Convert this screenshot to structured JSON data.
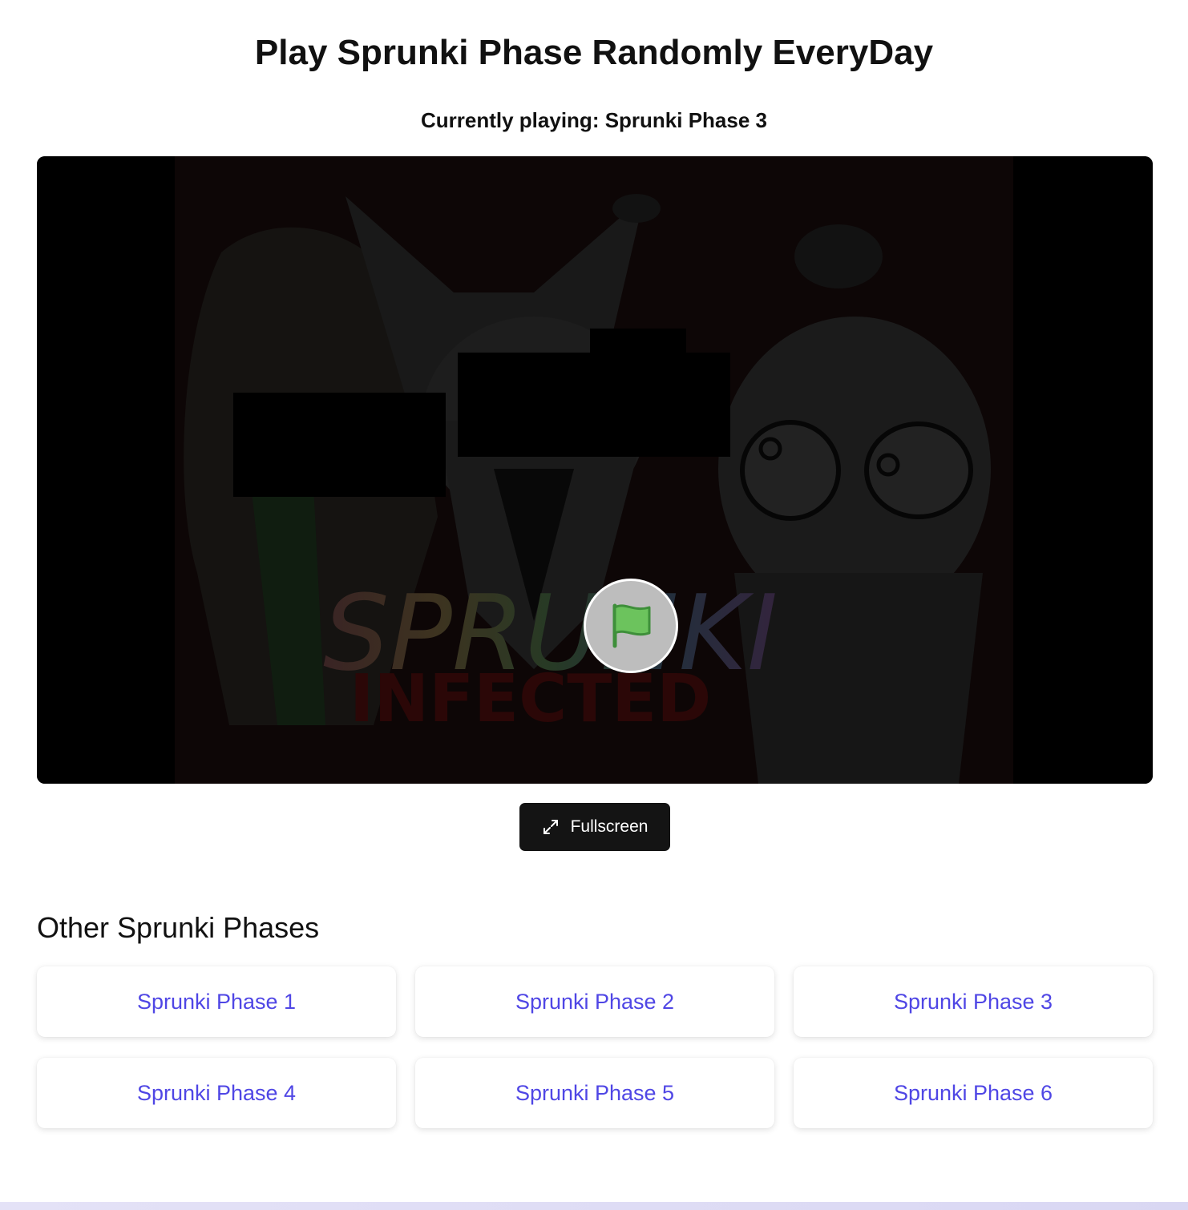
{
  "header": {
    "title": "Play Sprunki Phase Randomly EveryDay",
    "now_playing": "Currently playing: Sprunki Phase 3"
  },
  "player": {
    "background": "#000000",
    "artwork_title": "SPRUNKI",
    "artwork_subtitle": "INFECTED",
    "play_icon": "green-flag-icon",
    "play_button_color": "#bdbdbd",
    "flag_color": "#6cc35d"
  },
  "controls": {
    "fullscreen_label": "Fullscreen",
    "fullscreen_icon": "expand-arrows-icon"
  },
  "other_phases": {
    "heading": "Other Sprunki Phases",
    "link_color": "#4f46e5",
    "items": [
      {
        "label": "Sprunki Phase 1"
      },
      {
        "label": "Sprunki Phase 2"
      },
      {
        "label": "Sprunki Phase 3"
      },
      {
        "label": "Sprunki Phase 4"
      },
      {
        "label": "Sprunki Phase 5"
      },
      {
        "label": "Sprunki Phase 6"
      }
    ]
  }
}
